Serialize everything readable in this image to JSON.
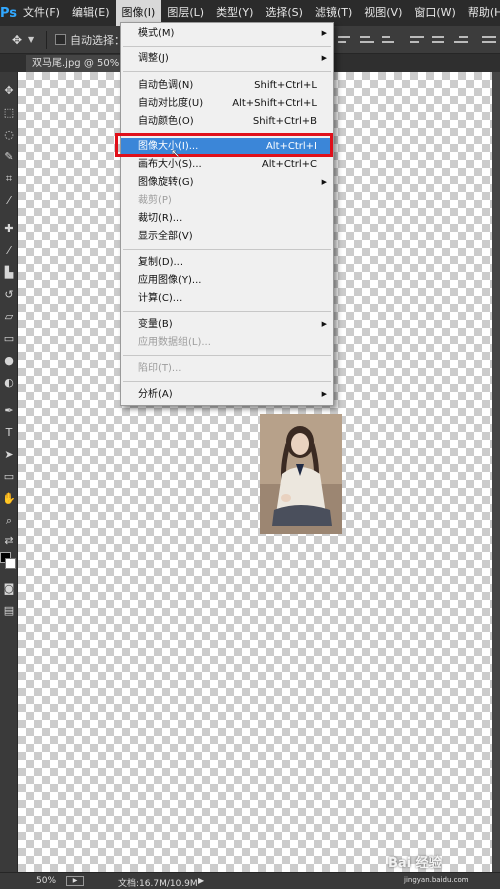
{
  "app": {
    "logo": "Ps"
  },
  "menubar": {
    "items": [
      {
        "label": "文件(F)"
      },
      {
        "label": "编辑(E)"
      },
      {
        "label": "图像(I)"
      },
      {
        "label": "图层(L)"
      },
      {
        "label": "类型(Y)"
      },
      {
        "label": "选择(S)"
      },
      {
        "label": "滤镜(T)"
      },
      {
        "label": "视图(V)"
      },
      {
        "label": "窗口(W)"
      },
      {
        "label": "帮助(H)"
      }
    ],
    "active_index": 2
  },
  "options_bar": {
    "auto_select_label": "自动选择："
  },
  "document_tab": {
    "title": "双马尾.jpg @ 50%"
  },
  "image_menu": {
    "items": [
      {
        "label": "模式(M)",
        "shortcut": "",
        "submenu": true,
        "disabled": false
      },
      {
        "label": "调整(J)",
        "shortcut": "",
        "submenu": true,
        "disabled": false
      },
      {
        "label": "自动色调(N)",
        "shortcut": "Shift+Ctrl+L",
        "submenu": false,
        "disabled": false
      },
      {
        "label": "自动对比度(U)",
        "shortcut": "Alt+Shift+Ctrl+L",
        "submenu": false,
        "disabled": false
      },
      {
        "label": "自动颜色(O)",
        "shortcut": "Shift+Ctrl+B",
        "submenu": false,
        "disabled": false
      },
      {
        "label": "图像大小(I)...",
        "shortcut": "Alt+Ctrl+I",
        "submenu": false,
        "disabled": false,
        "highlighted": true
      },
      {
        "label": "画布大小(S)...",
        "shortcut": "Alt+Ctrl+C",
        "submenu": false,
        "disabled": false
      },
      {
        "label": "图像旋转(G)",
        "shortcut": "",
        "submenu": true,
        "disabled": false
      },
      {
        "label": "裁剪(P)",
        "shortcut": "",
        "submenu": false,
        "disabled": true
      },
      {
        "label": "裁切(R)...",
        "shortcut": "",
        "submenu": false,
        "disabled": false
      },
      {
        "label": "显示全部(V)",
        "shortcut": "",
        "submenu": false,
        "disabled": false
      },
      {
        "label": "复制(D)...",
        "shortcut": "",
        "submenu": false,
        "disabled": false
      },
      {
        "label": "应用图像(Y)...",
        "shortcut": "",
        "submenu": false,
        "disabled": false
      },
      {
        "label": "计算(C)...",
        "shortcut": "",
        "submenu": false,
        "disabled": false
      },
      {
        "label": "变量(B)",
        "shortcut": "",
        "submenu": true,
        "disabled": false
      },
      {
        "label": "应用数据组(L)...",
        "shortcut": "",
        "submenu": false,
        "disabled": true
      },
      {
        "label": "陷印(T)...",
        "shortcut": "",
        "submenu": false,
        "disabled": true
      },
      {
        "label": "分析(A)",
        "shortcut": "",
        "submenu": true,
        "disabled": false
      }
    ]
  },
  "status_bar": {
    "zoom": "50%",
    "doc_info": "文档:16.7M/10.9M"
  },
  "watermark": {
    "brand": "Bai 经验",
    "url": "jingyan.baidu.com"
  },
  "colors": {
    "highlight": "#3b86d8",
    "annotation_box": "#e0101a",
    "ps_blue": "#31a8ff"
  }
}
